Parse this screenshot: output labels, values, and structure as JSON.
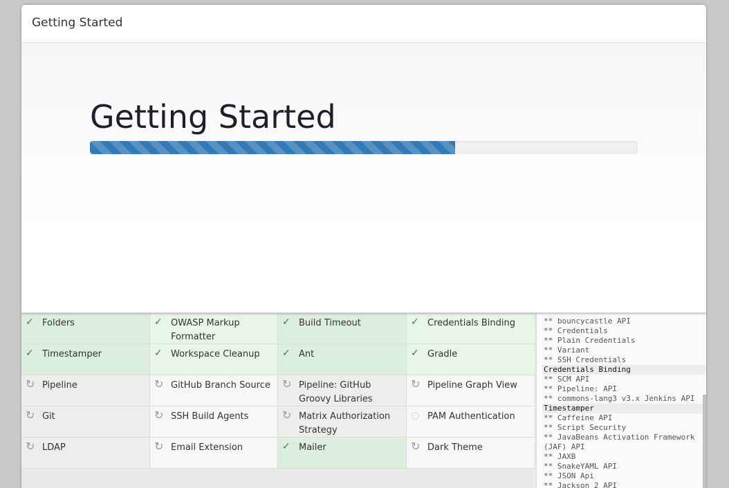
{
  "header": {
    "title": "Getting Started"
  },
  "hero": {
    "title": "Getting Started",
    "progress": 0.667
  },
  "plugins": [
    {
      "name": "Folders",
      "status": "installed"
    },
    {
      "name": "OWASP Markup Formatter",
      "status": "installed"
    },
    {
      "name": "Build Timeout",
      "status": "installed"
    },
    {
      "name": "Credentials Binding",
      "status": "installed"
    },
    {
      "name": "Timestamper",
      "status": "installed"
    },
    {
      "name": "Workspace Cleanup",
      "status": "installed"
    },
    {
      "name": "Ant",
      "status": "installed"
    },
    {
      "name": "Gradle",
      "status": "installed"
    },
    {
      "name": "Pipeline",
      "status": "pending"
    },
    {
      "name": "GitHub Branch Source",
      "status": "pending"
    },
    {
      "name": "Pipeline: GitHub Groovy Libraries",
      "status": "pending"
    },
    {
      "name": "Pipeline Graph View",
      "status": "pending"
    },
    {
      "name": "Git",
      "status": "pending"
    },
    {
      "name": "SSH Build Agents",
      "status": "pending"
    },
    {
      "name": "Matrix Authorization Strategy",
      "status": "pending"
    },
    {
      "name": "PAM Authentication",
      "status": "idle"
    },
    {
      "name": "LDAP",
      "status": "pending"
    },
    {
      "name": "Email Extension",
      "status": "pending"
    },
    {
      "name": "Mailer",
      "status": "installed"
    },
    {
      "name": "Dark Theme",
      "status": "pending"
    }
  ],
  "log": [
    {
      "text": "** bouncycastle API",
      "head": false
    },
    {
      "text": "** Credentials",
      "head": false
    },
    {
      "text": "** Plain Credentials",
      "head": false
    },
    {
      "text": "** Variant",
      "head": false
    },
    {
      "text": "** SSH Credentials",
      "head": false
    },
    {
      "text": "Credentials Binding",
      "head": true
    },
    {
      "text": "** SCM API",
      "head": false
    },
    {
      "text": "** Pipeline: API",
      "head": false
    },
    {
      "text": "** commons-lang3 v3.x Jenkins API",
      "head": false
    },
    {
      "text": "Timestamper",
      "head": true
    },
    {
      "text": "** Caffeine API",
      "head": false
    },
    {
      "text": "** Script Security",
      "head": false
    },
    {
      "text": "** JavaBeans Activation Framework (JAF) API",
      "head": false,
      "wrap": true
    },
    {
      "text": "** JAXB",
      "head": false
    },
    {
      "text": "** SnakeYAML API",
      "head": false
    },
    {
      "text": "** JSON Api",
      "head": false
    },
    {
      "text": "** Jackson 2 API",
      "head": false
    }
  ],
  "icons": {
    "installed": "check-icon",
    "pending": "refresh-icon",
    "idle": "circle-icon"
  },
  "colors": {
    "accent": "#337ab7",
    "installed_bg": "#dceedd",
    "pending_bg": "#ededed"
  }
}
